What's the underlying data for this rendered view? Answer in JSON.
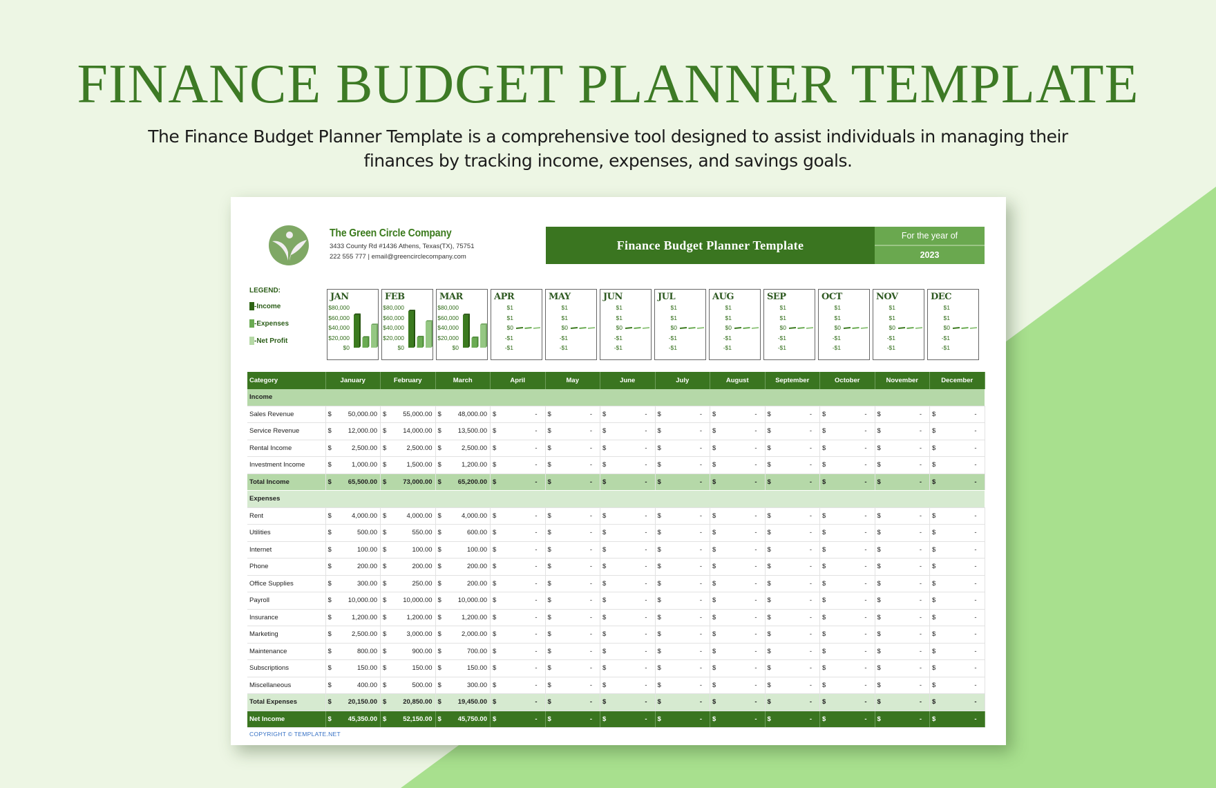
{
  "page": {
    "title": "FINANCE BUDGET PLANNER TEMPLATE",
    "description": "The Finance Budget Planner Template is a comprehensive tool designed to assist individuals in managing their finances by tracking income, expenses, and savings goals."
  },
  "company": {
    "name": "The Green Circle Company",
    "address": "3433 County Rd #1436 Athens, Texas(TX), 75751",
    "contact": "222 555 777 | email@greencirclecompany.com"
  },
  "banner": {
    "title": "Finance Budget Planner Template",
    "year_label": "For the year of",
    "year": "2023"
  },
  "legend": {
    "title": "LEGEND:",
    "items": [
      {
        "label": "-Income",
        "color": "#2e6414"
      },
      {
        "label": "-Expenses",
        "color": "#6aab52"
      },
      {
        "label": "-Net Profit",
        "color": "#b6d9a6"
      }
    ]
  },
  "colors": {
    "primary": "#3a7520",
    "accent": "#6aa84f",
    "section": "#b5d8a8",
    "section_light": "#d6ead0",
    "income_bar": "#3b7a1f",
    "expenses_bar": "#6aab52",
    "net_bar": "#95c783"
  },
  "chart_data": [
    {
      "type": "bar",
      "title": "JAN",
      "categories": [
        "Income",
        "Expenses",
        "Net Profit"
      ],
      "values": [
        65500,
        20150,
        45350
      ],
      "ticks": [
        "$80,000",
        "$60,000",
        "$40,000",
        "$20,000",
        "$0"
      ],
      "ylim": [
        0,
        80000
      ]
    },
    {
      "type": "bar",
      "title": "FEB",
      "categories": [
        "Income",
        "Expenses",
        "Net Profit"
      ],
      "values": [
        73000,
        20850,
        52150
      ],
      "ticks": [
        "$80,000",
        "$60,000",
        "$40,000",
        "$20,000",
        "$0"
      ],
      "ylim": [
        0,
        80000
      ]
    },
    {
      "type": "bar",
      "title": "MAR",
      "categories": [
        "Income",
        "Expenses",
        "Net Profit"
      ],
      "values": [
        65200,
        19450,
        45750
      ],
      "ticks": [
        "$80,000",
        "$60,000",
        "$40,000",
        "$20,000",
        "$0"
      ],
      "ylim": [
        0,
        80000
      ]
    },
    {
      "type": "bar",
      "title": "APR",
      "categories": [
        "Income",
        "Expenses",
        "Net Profit"
      ],
      "values": [
        0,
        0,
        0
      ],
      "ticks": [
        "$1",
        "$1",
        "$0",
        "-$1",
        "-$1"
      ],
      "ylim": [
        -1,
        1
      ]
    },
    {
      "type": "bar",
      "title": "MAY",
      "categories": [
        "Income",
        "Expenses",
        "Net Profit"
      ],
      "values": [
        0,
        0,
        0
      ],
      "ticks": [
        "$1",
        "$1",
        "$0",
        "-$1",
        "-$1"
      ],
      "ylim": [
        -1,
        1
      ]
    },
    {
      "type": "bar",
      "title": "JUN",
      "categories": [
        "Income",
        "Expenses",
        "Net Profit"
      ],
      "values": [
        0,
        0,
        0
      ],
      "ticks": [
        "$1",
        "$1",
        "$0",
        "-$1",
        "-$1"
      ],
      "ylim": [
        -1,
        1
      ]
    },
    {
      "type": "bar",
      "title": "JUL",
      "categories": [
        "Income",
        "Expenses",
        "Net Profit"
      ],
      "values": [
        0,
        0,
        0
      ],
      "ticks": [
        "$1",
        "$1",
        "$0",
        "-$1",
        "-$1"
      ],
      "ylim": [
        -1,
        1
      ]
    },
    {
      "type": "bar",
      "title": "AUG",
      "categories": [
        "Income",
        "Expenses",
        "Net Profit"
      ],
      "values": [
        0,
        0,
        0
      ],
      "ticks": [
        "$1",
        "$1",
        "$0",
        "-$1",
        "-$1"
      ],
      "ylim": [
        -1,
        1
      ]
    },
    {
      "type": "bar",
      "title": "SEP",
      "categories": [
        "Income",
        "Expenses",
        "Net Profit"
      ],
      "values": [
        0,
        0,
        0
      ],
      "ticks": [
        "$1",
        "$1",
        "$0",
        "-$1",
        "-$1"
      ],
      "ylim": [
        -1,
        1
      ]
    },
    {
      "type": "bar",
      "title": "OCT",
      "categories": [
        "Income",
        "Expenses",
        "Net Profit"
      ],
      "values": [
        0,
        0,
        0
      ],
      "ticks": [
        "$1",
        "$1",
        "$0",
        "-$1",
        "-$1"
      ],
      "ylim": [
        -1,
        1
      ]
    },
    {
      "type": "bar",
      "title": "NOV",
      "categories": [
        "Income",
        "Expenses",
        "Net Profit"
      ],
      "values": [
        0,
        0,
        0
      ],
      "ticks": [
        "$1",
        "$1",
        "$0",
        "-$1",
        "-$1"
      ],
      "ylim": [
        -1,
        1
      ]
    },
    {
      "type": "bar",
      "title": "DEC",
      "categories": [
        "Income",
        "Expenses",
        "Net Profit"
      ],
      "values": [
        0,
        0,
        0
      ],
      "ticks": [
        "$1",
        "$1",
        "$0",
        "-$1",
        "-$1"
      ],
      "ylim": [
        -1,
        1
      ]
    }
  ],
  "table": {
    "headers": [
      "Category",
      "January",
      "February",
      "March",
      "April",
      "May",
      "June",
      "July",
      "August",
      "September",
      "October",
      "November",
      "December"
    ],
    "currency": "$",
    "empty": "-",
    "rows": [
      {
        "kind": "section",
        "label": "Income"
      },
      {
        "kind": "item",
        "label": "Sales Revenue",
        "values": [
          "50,000.00",
          "55,000.00",
          "48,000.00"
        ]
      },
      {
        "kind": "item",
        "label": "Service Revenue",
        "values": [
          "12,000.00",
          "14,000.00",
          "13,500.00"
        ]
      },
      {
        "kind": "item",
        "label": "Rental Income",
        "values": [
          "2,500.00",
          "2,500.00",
          "2,500.00"
        ]
      },
      {
        "kind": "item",
        "label": "Investment Income",
        "values": [
          "1,000.00",
          "1,500.00",
          "1,200.00"
        ]
      },
      {
        "kind": "total",
        "label": "Total Income",
        "values": [
          "65,500.00",
          "73,000.00",
          "65,200.00"
        ]
      },
      {
        "kind": "section2",
        "label": "Expenses"
      },
      {
        "kind": "item",
        "label": "Rent",
        "values": [
          "4,000.00",
          "4,000.00",
          "4,000.00"
        ]
      },
      {
        "kind": "item",
        "label": "Utilities",
        "values": [
          "500.00",
          "550.00",
          "600.00"
        ]
      },
      {
        "kind": "item",
        "label": "Internet",
        "values": [
          "100.00",
          "100.00",
          "100.00"
        ]
      },
      {
        "kind": "item",
        "label": "Phone",
        "values": [
          "200.00",
          "200.00",
          "200.00"
        ]
      },
      {
        "kind": "item",
        "label": "Office Supplies",
        "values": [
          "300.00",
          "250.00",
          "200.00"
        ]
      },
      {
        "kind": "item",
        "label": "Payroll",
        "values": [
          "10,000.00",
          "10,000.00",
          "10,000.00"
        ]
      },
      {
        "kind": "item",
        "label": "Insurance",
        "values": [
          "1,200.00",
          "1,200.00",
          "1,200.00"
        ]
      },
      {
        "kind": "item",
        "label": "Marketing",
        "values": [
          "2,500.00",
          "3,000.00",
          "2,000.00"
        ]
      },
      {
        "kind": "item",
        "label": "Maintenance",
        "values": [
          "800.00",
          "900.00",
          "700.00"
        ]
      },
      {
        "kind": "item",
        "label": "Subscriptions",
        "values": [
          "150.00",
          "150.00",
          "150.00"
        ]
      },
      {
        "kind": "item",
        "label": "Miscellaneous",
        "values": [
          "400.00",
          "500.00",
          "300.00"
        ]
      },
      {
        "kind": "totalexp",
        "label": "Total Expenses",
        "values": [
          "20,150.00",
          "20,850.00",
          "19,450.00"
        ]
      },
      {
        "kind": "net",
        "label": "Net Income",
        "values": [
          "45,350.00",
          "52,150.00",
          "45,750.00"
        ]
      }
    ]
  },
  "footer": {
    "copyright": "COPYRIGHT © TEMPLATE.NET"
  }
}
